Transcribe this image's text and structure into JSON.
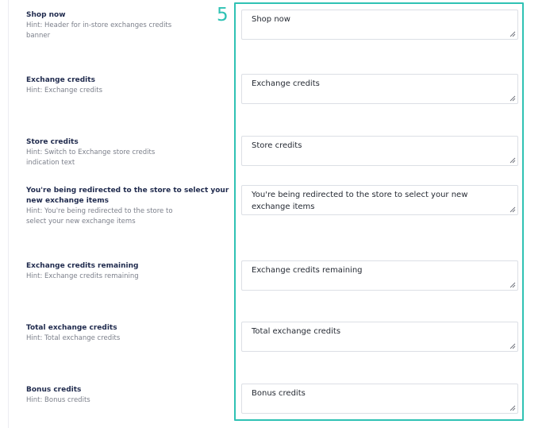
{
  "step": "5",
  "fields": [
    {
      "title": "Shop now",
      "hint": "Hint: Header for in-store exchanges credits banner",
      "value": "Shop now"
    },
    {
      "title": "Exchange credits",
      "hint": "Hint: Exchange credits",
      "value": "Exchange credits"
    },
    {
      "title": "Store credits",
      "hint": "Hint: Switch to Exchange store credits indication text",
      "value": "Store credits"
    },
    {
      "title": "You're being redirected to the store to select your new exchange items",
      "hint": "Hint: You're being redirected to the store to select your new exchange items",
      "value": "You're being redirected to the store to select your new exchange items"
    },
    {
      "title": "Exchange credits remaining",
      "hint": "Hint: Exchange credits remaining",
      "value": "Exchange credits remaining"
    },
    {
      "title": "Total exchange credits",
      "hint": "Hint: Total exchange credits",
      "value": "Total exchange credits"
    },
    {
      "title": "Bonus credits",
      "hint": "Hint: Bonus credits",
      "value": "Bonus credits"
    }
  ],
  "colors": {
    "accent": "#2fc2b4",
    "label_title": "#1f2a4d",
    "hint_text": "#7b7f8a",
    "border": "#dcdfe5"
  },
  "icons": {
    "resize_handle": "resize-handle-icon"
  }
}
